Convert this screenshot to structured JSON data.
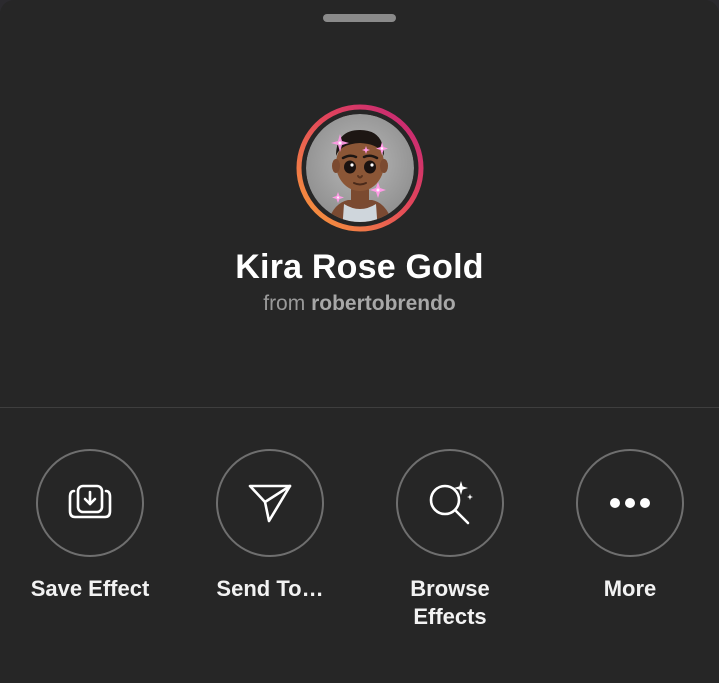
{
  "effect": {
    "name": "Kira Rose Gold",
    "from_prefix": "from",
    "author": "robertobrendo"
  },
  "actions": [
    {
      "label": "Save Effect",
      "icon": "save-effect-icon"
    },
    {
      "label": "Send To…",
      "icon": "send-icon"
    },
    {
      "label": "Browse\nEffects",
      "icon": "browse-effects-icon"
    },
    {
      "label": "More",
      "icon": "more-icon"
    }
  ],
  "colors": {
    "sheet_background": "#262626",
    "ring_gradient_start": "#f9a137",
    "ring_gradient_end": "#c1227a",
    "text_primary": "#ffffff",
    "text_secondary": "#9a9a9a"
  }
}
